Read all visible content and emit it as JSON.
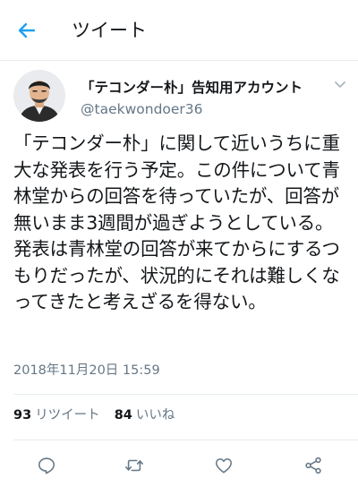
{
  "header": {
    "title": "ツイート",
    "back_icon": "arrow-left-icon",
    "accent": "#1da1f2"
  },
  "tweet": {
    "display_name": "「テコンダー朴」告知用アカウント",
    "handle": "@taekwondoer36",
    "text": "「テコンダー朴」に関して近いうちに重大な発表を行う予定。この件について青林堂からの回答を待っていたが、回答が無いまま3週間が過ぎようとしている。発表は青林堂の回答が来てからにするつもりだったが、状況的にそれは難しくなってきたと考えざるを得ない。",
    "timestamp": "2018年11月20日 15:59"
  },
  "stats": {
    "retweets_count": "93",
    "retweets_label": "リツイート",
    "likes_count": "84",
    "likes_label": "いいね"
  },
  "actions": [
    {
      "icon": "reply-icon"
    },
    {
      "icon": "retweet-icon"
    },
    {
      "icon": "like-icon"
    },
    {
      "icon": "share-icon"
    }
  ],
  "colors": {
    "text": "#14171a",
    "secondary": "#657786",
    "divider": "#e6ecf0",
    "accent": "#1da1f2"
  }
}
